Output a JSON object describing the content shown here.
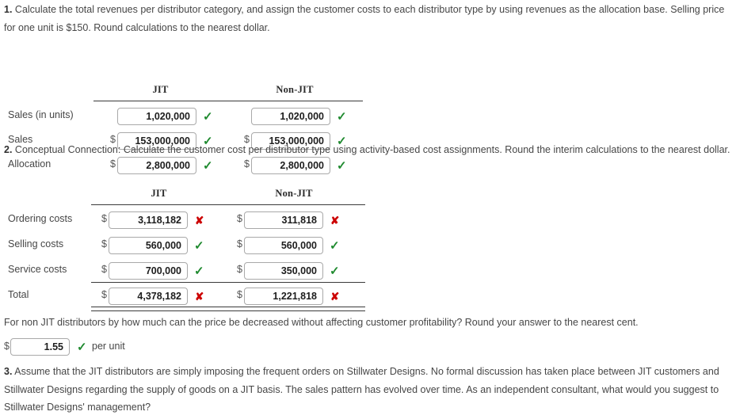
{
  "questions": {
    "q1": {
      "number": "1.",
      "text": "Calculate the total revenues per distributor category, and assign the customer costs to each distributor type by using revenues as the allocation base. Selling price for one unit is $150. Round calculations to the nearest dollar."
    },
    "q2": {
      "number": "2.",
      "text": "Conceptual Connection: Calculate the customer cost per distributor type using activity-based cost assignments. Round the interim calculations to the nearest dollar."
    },
    "q_mid": {
      "number": "",
      "text": "For non JIT distributors by how much can the price be decreased without affecting customer profitability? Round your answer to the nearest cent."
    },
    "q3": {
      "number": "3.",
      "text": "Assume that the JIT distributors are simply imposing the frequent orders on Stillwater Designs. No formal discussion has taken place between JIT customers and Stillwater Designs regarding the supply of goods on a JIT basis. The sales pattern has evolved over time. As an independent consultant, what would you suggest to Stillwater Designs' management?"
    }
  },
  "table1": {
    "columns": [
      "JIT",
      "Non-JIT"
    ],
    "rows": [
      {
        "label": "Sales (in units)",
        "cells": [
          {
            "currency": "",
            "value": "1,020,000",
            "status": "correct"
          },
          {
            "currency": "",
            "value": "1,020,000",
            "status": "correct"
          }
        ]
      },
      {
        "label": "Sales",
        "cells": [
          {
            "currency": "$",
            "value": "153,000,000",
            "status": "correct"
          },
          {
            "currency": "$",
            "value": "153,000,000",
            "status": "correct"
          }
        ]
      },
      {
        "label": "Allocation",
        "cells": [
          {
            "currency": "$",
            "value": "2,800,000",
            "status": "correct"
          },
          {
            "currency": "$",
            "value": "2,800,000",
            "status": "correct"
          }
        ]
      }
    ]
  },
  "table2": {
    "columns": [
      "JIT",
      "Non-JIT"
    ],
    "rows": [
      {
        "label": "Ordering costs",
        "cells": [
          {
            "currency": "$",
            "value": "3,118,182",
            "status": "incorrect"
          },
          {
            "currency": "$",
            "value": "311,818",
            "status": "incorrect"
          }
        ]
      },
      {
        "label": "Selling costs",
        "cells": [
          {
            "currency": "$",
            "value": "560,000",
            "status": "correct"
          },
          {
            "currency": "$",
            "value": "560,000",
            "status": "correct"
          }
        ]
      },
      {
        "label": "Service costs",
        "cells": [
          {
            "currency": "$",
            "value": "700,000",
            "status": "correct"
          },
          {
            "currency": "$",
            "value": "350,000",
            "status": "correct"
          }
        ]
      },
      {
        "label": "Total",
        "cells": [
          {
            "currency": "$",
            "value": "4,378,182",
            "status": "incorrect"
          },
          {
            "currency": "$",
            "value": "1,221,818",
            "status": "incorrect"
          }
        ]
      }
    ]
  },
  "price_answer": {
    "currency": "$",
    "value": "1.55",
    "status": "correct",
    "suffix": "per unit"
  },
  "symbols": {
    "check": "✓",
    "cross": "✘"
  },
  "colors": {
    "correct": "#1f8a2f",
    "incorrect": "#cc0000",
    "text": "#464646",
    "rule": "#3a3a3a",
    "input_border": "#a9a9a9"
  }
}
